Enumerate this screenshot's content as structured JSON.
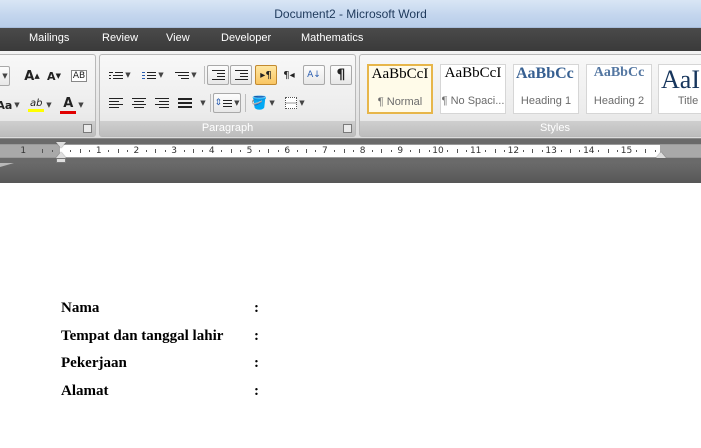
{
  "window": {
    "title": "Document2 - Microsoft Word"
  },
  "tabs": [
    "Mailings",
    "Review",
    "View",
    "Developer",
    "Mathematics"
  ],
  "ribbon": {
    "font_group": {
      "grow_font_label": "A",
      "shrink_font_label": "A",
      "clear_formatting_label": "AB",
      "change_case_label": "Aa",
      "highlight_label": "ab",
      "font_color_label": "A",
      "highlight_color": "#ffff00",
      "font_color": "#e00000"
    },
    "paragraph_group": {
      "label": "Paragraph",
      "show_marks_label": "¶",
      "ltr_label": "▸¶",
      "rtl_label": "¶◂",
      "sort_label": "A↓"
    },
    "styles_group": {
      "label": "Styles",
      "items": [
        {
          "sample": "AaBbCcI",
          "name": "¶ Normal",
          "selected": true
        },
        {
          "sample": "AaBbCcI",
          "name": "¶ No Spaci...",
          "selected": false
        },
        {
          "sample": "AaBbCc",
          "name": "Heading 1",
          "selected": false
        },
        {
          "sample": "AaBbCc",
          "name": "Heading 2",
          "selected": false
        },
        {
          "sample": "AaI",
          "name": "Title",
          "selected": false
        }
      ],
      "heading_color": "#365f91"
    }
  },
  "ruler": {
    "numbers": [
      "1",
      "1",
      "2",
      "3",
      "4",
      "5",
      "6",
      "7",
      "8",
      "9",
      "10",
      "11",
      "12",
      "13",
      "14",
      "15"
    ]
  },
  "document": {
    "fields": [
      {
        "label": "Nama",
        "colon": ":"
      },
      {
        "label": "Tempat dan tanggal lahir",
        "colon": ":"
      },
      {
        "label": "Pekerjaan",
        "colon": ":"
      },
      {
        "label": "Alamat",
        "colon": ":"
      }
    ]
  }
}
